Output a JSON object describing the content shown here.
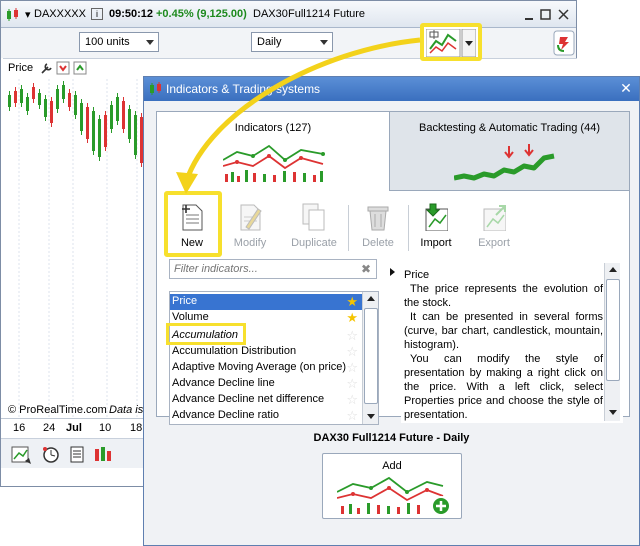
{
  "background_window": {
    "title_symbol": "DAXXXXX",
    "time": "09:50:12",
    "change": "+0.45% (9,125.00)",
    "instrument": "DAX30",
    "contract": "Full1214 Future",
    "units": "100 units",
    "period": "Daily",
    "price_label": "Price",
    "copyright": "© ProRealTime.com",
    "data_note": "Data is",
    "axis_ticks": [
      "16",
      "24",
      "Jul",
      "10",
      "18"
    ]
  },
  "dialog": {
    "title": "Indicators & Trading systems",
    "tabs": [
      {
        "label": "Indicators (127)"
      },
      {
        "label": "Backtesting & Automatic Trading (44)"
      }
    ],
    "toolbar": {
      "new": "New",
      "modify": "Modify",
      "duplicate": "Duplicate",
      "delete": "Delete",
      "import": "Import",
      "export": "Export"
    },
    "filter_placeholder": "Filter indicators...",
    "list": [
      {
        "label": "Price",
        "selected": true,
        "favorite": true
      },
      {
        "label": "Volume",
        "favorite": true
      },
      {
        "label": "Accumulation",
        "category": true
      },
      {
        "label": "Accumulation Distribution"
      },
      {
        "label": "Adaptive Moving Average (on price)"
      },
      {
        "label": "Advance Decline line"
      },
      {
        "label": "Advance Decline net difference"
      },
      {
        "label": "Advance Decline ratio"
      }
    ],
    "description": {
      "heading": "Price",
      "paragraphs": [
        "The price represents the evolution of the stock.",
        "It can be presented in several forms (curve, bar chart, candlestick, mountain, histogram).",
        "You can modify the style of presentation by making a right click on the price. With a left click, select Properties price and choose the style of presentation."
      ]
    },
    "footer_title": "DAX30  Full1214 Future - Daily",
    "add_label": "Add"
  },
  "colors": {
    "highlight": "#f7e02d",
    "selection": "#3874d1",
    "positive_change": "#1d8a1d",
    "title_bar": "#3a6fbf"
  }
}
